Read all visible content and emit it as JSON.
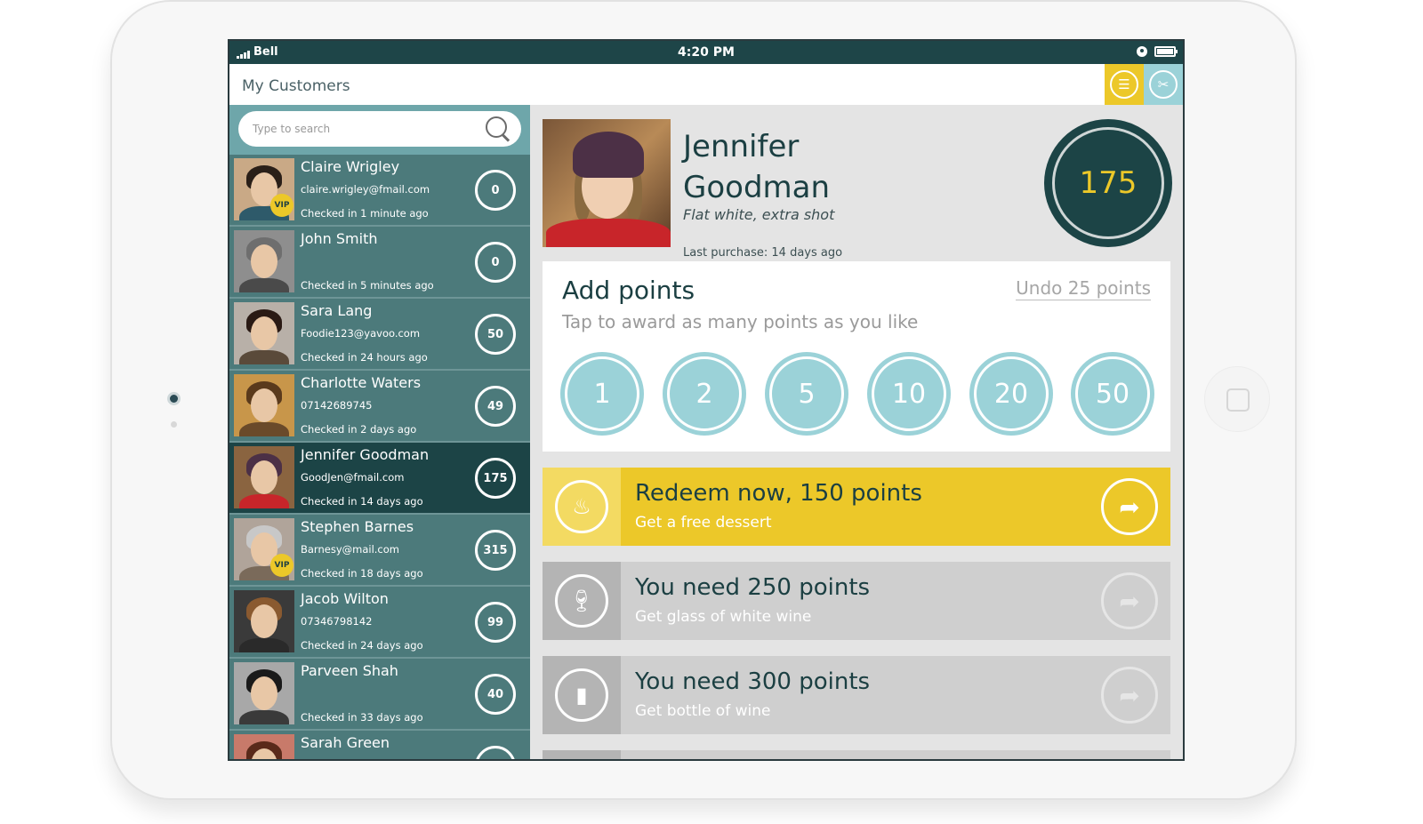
{
  "status_bar": {
    "carrier": "Bell",
    "time": "4:20 PM"
  },
  "header": {
    "title": "My Customers",
    "list_icon": "list-icon",
    "tools_icon": "scissors-icon"
  },
  "search": {
    "placeholder": "Type to search"
  },
  "customers": [
    {
      "name": "Claire Wrigley",
      "email": "claire.wrigley@fmail.com",
      "checked": "Checked in 1 minute ago",
      "points": "0",
      "vip": "VIP"
    },
    {
      "name": "John Smith",
      "email": "",
      "checked": "Checked in 5 minutes ago",
      "points": "0",
      "vip": ""
    },
    {
      "name": "Sara Lang",
      "email": "Foodie123@yavoo.com",
      "checked": "Checked in 24 hours ago",
      "points": "50",
      "vip": ""
    },
    {
      "name": "Charlotte Waters",
      "email": "07142689745",
      "checked": "Checked in 2 days ago",
      "points": "49",
      "vip": ""
    },
    {
      "name": "Jennifer Goodman",
      "email": "GoodJen@fmail.com",
      "checked": "Checked in 14 days ago",
      "points": "175",
      "vip": ""
    },
    {
      "name": "Stephen Barnes",
      "email": "Barnesy@mail.com",
      "checked": "Checked in 18 days ago",
      "points": "315",
      "vip": "VIP"
    },
    {
      "name": "Jacob Wilton",
      "email": "07346798142",
      "checked": "Checked in 24 days ago",
      "points": "99",
      "vip": ""
    },
    {
      "name": "Parveen Shah",
      "email": "",
      "checked": "Checked in 33 days ago",
      "points": "40",
      "vip": ""
    },
    {
      "name": "Sarah Green",
      "email": "",
      "checked": "",
      "points": "",
      "vip": ""
    }
  ],
  "selected": {
    "name_line1": "Jennifer",
    "name_line2": "Goodman",
    "preference": "Flat white, extra shot",
    "last_purchase": "Last purchase: 14 days ago",
    "points": "175"
  },
  "add_points": {
    "title": "Add points",
    "undo": "Undo 25 points",
    "subtitle": "Tap to award as many points as you like",
    "values": [
      "1",
      "2",
      "5",
      "10",
      "20",
      "50"
    ]
  },
  "rewards": [
    {
      "title": "Redeem now, 150 points",
      "subtitle": "Get a free dessert",
      "icon": "cupcake-icon",
      "state": "available"
    },
    {
      "title": "You need 250 points",
      "subtitle": "Get glass of white wine",
      "icon": "wine-glass-icon",
      "state": "locked"
    },
    {
      "title": "You need 300 points",
      "subtitle": "Get bottle of wine",
      "icon": "wine-bottle-icon",
      "state": "locked"
    }
  ],
  "colors": {
    "dark_teal": "#1c4446",
    "teal": "#4c7a7b",
    "light_teal": "#9bd2d8",
    "yellow": "#ecc829"
  }
}
